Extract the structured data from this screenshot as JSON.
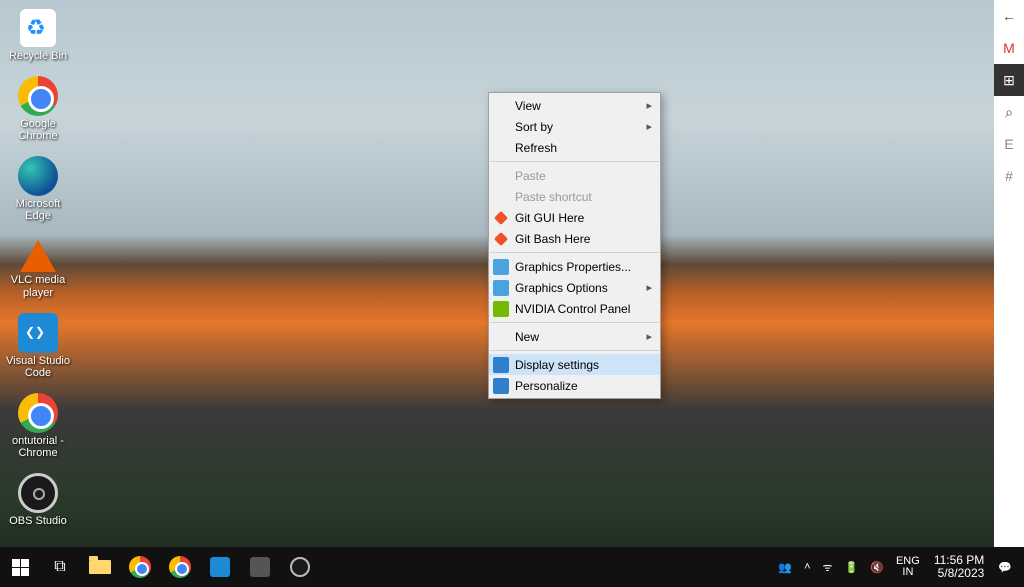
{
  "desktop_icons": [
    {
      "label": "Recycle Bin"
    },
    {
      "label": "Google Chrome"
    },
    {
      "label": "Microsoft Edge"
    },
    {
      "label": "VLC media player"
    },
    {
      "label": "Visual Studio Code"
    },
    {
      "label": "ontutorial - Chrome"
    },
    {
      "label": "OBS Studio"
    }
  ],
  "context_menu": {
    "view": "View",
    "sort_by": "Sort by",
    "refresh": "Refresh",
    "paste": "Paste",
    "paste_shortcut": "Paste shortcut",
    "git_gui": "Git GUI Here",
    "git_bash": "Git Bash Here",
    "gfx_props": "Graphics Properties...",
    "gfx_opts": "Graphics Options",
    "nvidia": "NVIDIA Control Panel",
    "new": "New",
    "display_settings": "Display settings",
    "personalize": "Personalize"
  },
  "tray": {
    "lang_code": "ENG",
    "lang_region": "IN",
    "time": "11:56 PM",
    "date": "5/8/2023"
  }
}
